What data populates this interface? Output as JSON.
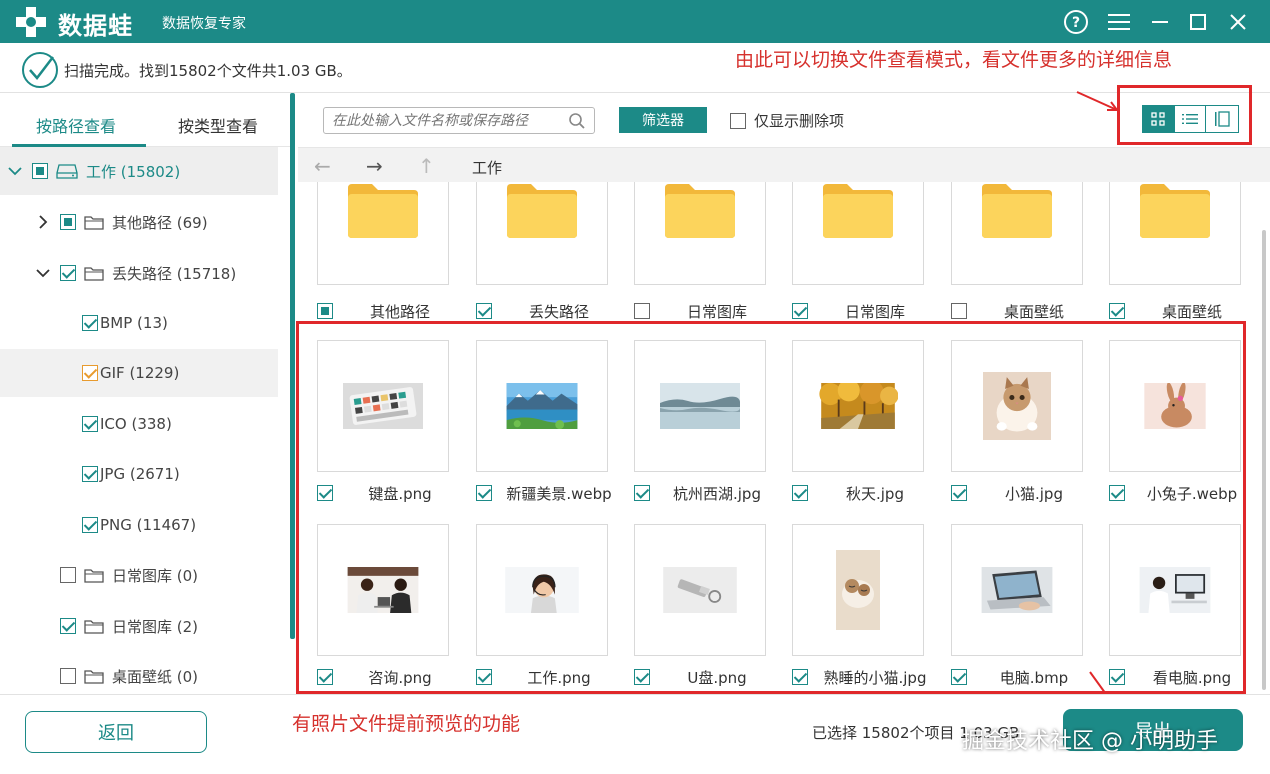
{
  "app": {
    "brand": "数据蛙",
    "subtitle": "数据恢复专家"
  },
  "status": {
    "text": "扫描完成。找到15802个文件共1.03 GB。"
  },
  "annotations": {
    "top": "由此可以切换文件查看模式，看文件更多的详细信息",
    "bottom": "有照片文件提前预览的功能"
  },
  "tabs": [
    {
      "label": "按路径查看",
      "active": true
    },
    {
      "label": "按类型查看",
      "active": false
    }
  ],
  "tree": [
    {
      "label": "工作 (15802)",
      "level": 0,
      "state": "partial",
      "expanded": true,
      "icon": "drive-icon"
    },
    {
      "label": "其他路径 (69)",
      "level": 1,
      "state": "partial",
      "expanded": false,
      "icon": "folder-icon"
    },
    {
      "label": "丢失路径 (15718)",
      "level": 1,
      "state": "checked",
      "expanded": true,
      "icon": "folder-icon"
    },
    {
      "label": "BMP (13)",
      "level": 2,
      "state": "checked"
    },
    {
      "label": "GIF (1229)",
      "level": 2,
      "state": "checked-orange"
    },
    {
      "label": "ICO (338)",
      "level": 2,
      "state": "checked"
    },
    {
      "label": "JPG (2671)",
      "level": 2,
      "state": "checked"
    },
    {
      "label": "PNG (11467)",
      "level": 2,
      "state": "checked"
    },
    {
      "label": "日常图库 (0)",
      "level": 1,
      "state": "empty",
      "icon": "folder-icon"
    },
    {
      "label": "日常图库 (2)",
      "level": 1,
      "state": "checked",
      "icon": "folder-icon"
    },
    {
      "label": "桌面壁纸 (0)",
      "level": 1,
      "state": "empty",
      "icon": "folder-icon"
    }
  ],
  "toolbar": {
    "search_placeholder": "在此处输入文件名称或保存路径",
    "filter_label": "筛选器",
    "only_deleted_label": "仅显示删除项"
  },
  "nav": {
    "breadcrumb": "工作"
  },
  "folders": [
    {
      "name": "其他路径",
      "state": "partial"
    },
    {
      "name": "丢失路径",
      "state": "checked"
    },
    {
      "name": "日常图库",
      "state": "empty"
    },
    {
      "name": "日常图库",
      "state": "checked"
    },
    {
      "name": "桌面壁纸",
      "state": "empty"
    },
    {
      "name": "桌面壁纸",
      "state": "checked"
    }
  ],
  "files": [
    {
      "name": "键盘.png",
      "thumb": "keyboard"
    },
    {
      "name": "新疆美景.webp",
      "thumb": "lake"
    },
    {
      "name": "杭州西湖.jpg",
      "thumb": "westlake"
    },
    {
      "name": "秋天.jpg",
      "thumb": "autumn"
    },
    {
      "name": "小猫.jpg",
      "thumb": "kitten"
    },
    {
      "name": "小兔子.webp",
      "thumb": "bunny"
    },
    {
      "name": "咨询.png",
      "thumb": "meeting"
    },
    {
      "name": "工作.png",
      "thumb": "headset"
    },
    {
      "name": "U盘.png",
      "thumb": "usb"
    },
    {
      "name": "熟睡的小猫.jpg",
      "thumb": "sleepcat"
    },
    {
      "name": "电脑.bmp",
      "thumb": "laptop"
    },
    {
      "name": "看电脑.png",
      "thumb": "office"
    }
  ],
  "footer": {
    "back_label": "返回",
    "selected_info": "已选择 15802个项目 1.03 GB",
    "export_label": "导出",
    "watermark": "掘金技术社区 @ 小明助手"
  },
  "colors": {
    "accent": "#1c8a87",
    "annotation": "#d6312d"
  }
}
